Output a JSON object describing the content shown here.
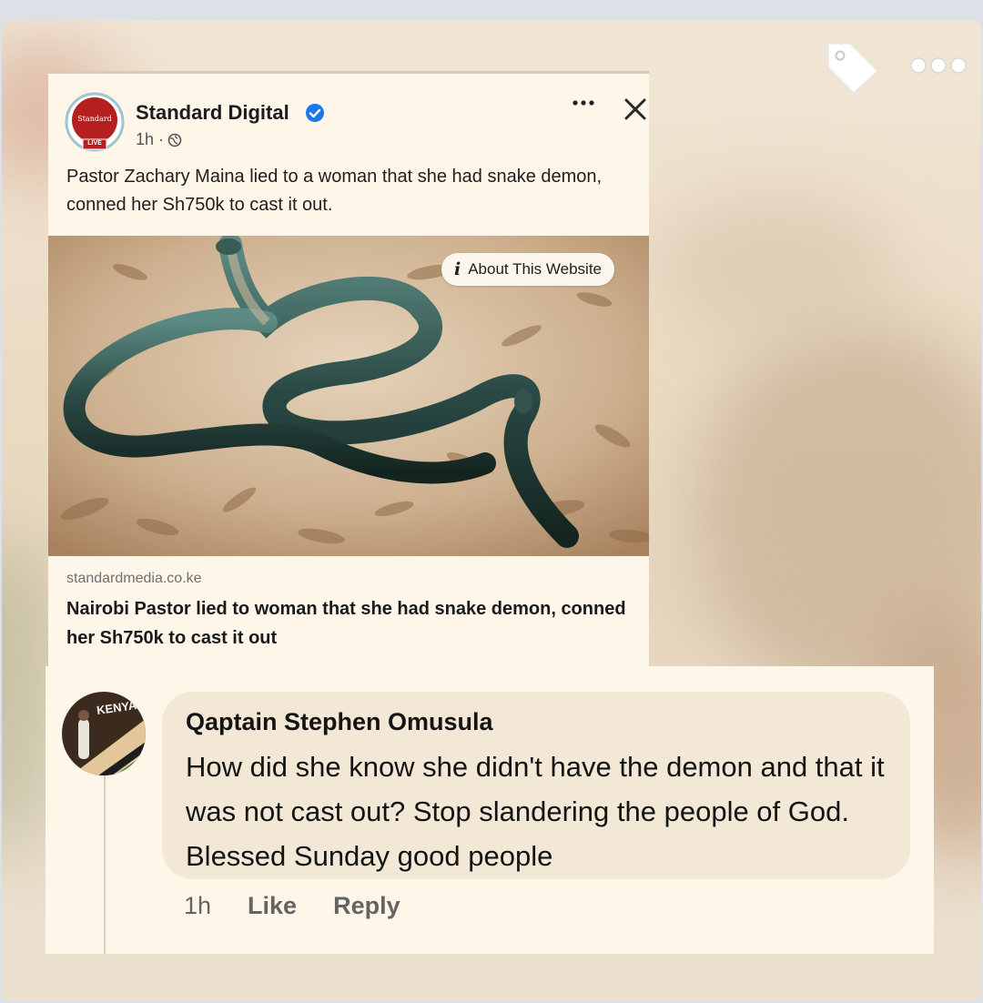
{
  "post": {
    "page_name": "Standard Digital",
    "time": "1h ·",
    "text": "Pastor Zachary Maina lied to a woman that she had snake demon, conned her Sh750k to cast it out.",
    "logo_text": "Standard",
    "logo_badge": "LIVE",
    "about_label": "About This Website",
    "link_domain": "standardmedia.co.ke",
    "link_title": "Nairobi Pastor lied to woman that she had snake demon, conned her Sh750k to cast it out"
  },
  "comment": {
    "author": "Qaptain Stephen Omusula",
    "avatar_text": "KENYA",
    "text": "How did she know she didn't have the demon and that it was not cast out? Stop slandering the people of God. Blessed Sunday good people",
    "time": "1h",
    "like_label": "Like",
    "reply_label": "Reply"
  },
  "icons": {
    "top_right": [
      "tag-icon",
      "more-options-icon"
    ],
    "post_header": [
      "verified-icon",
      "globe-icon",
      "more-options-icon",
      "close-icon"
    ],
    "info": "info-icon"
  },
  "colors": {
    "background": "#f1e6d6",
    "card": "#fdf6e9",
    "bubble": "#f2e8d5",
    "verified": "#1877f2",
    "brand_red": "#b51f1f"
  }
}
